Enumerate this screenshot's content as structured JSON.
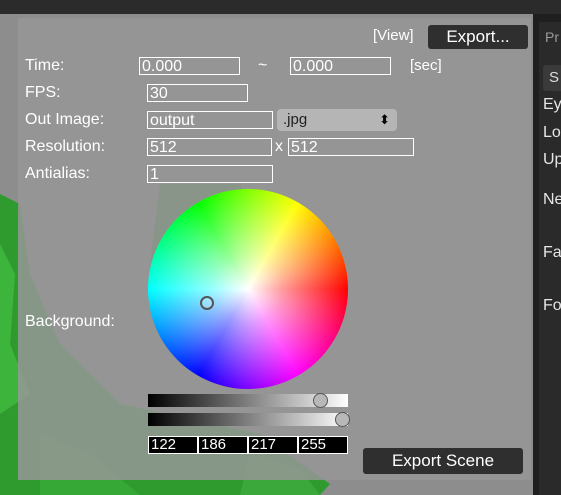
{
  "dialog": {
    "view_label": "[View]",
    "export_button": "Export...",
    "time_label": "Time:",
    "time_start": "0.000",
    "time_sep": "~",
    "time_end": "0.000",
    "time_unit": "[sec]",
    "fps_label": "FPS:",
    "fps_value": "30",
    "out_image_label": "Out Image:",
    "out_image_value": "output",
    "format_selected": ".jpg",
    "format_arrow": "⬍",
    "resolution_label": "Resolution:",
    "res_w": "512",
    "res_x": "x",
    "res_h": "512",
    "antialias_label": "Antialias:",
    "antialias_value": "1",
    "background_label": "Background:",
    "rgba": [
      "122",
      "186",
      "217",
      "255"
    ],
    "brightness_level": 0.86,
    "alpha_level": 1.0,
    "export_scene_button": "Export Scene"
  },
  "right_panel": {
    "tab": "Pr",
    "button": "S",
    "items": [
      "Ey",
      "Lo",
      "Up",
      "Ne",
      "Fa",
      "Fo"
    ]
  }
}
